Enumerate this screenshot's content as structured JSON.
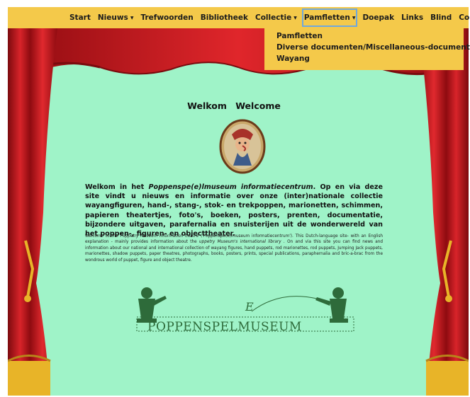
{
  "nav": {
    "items": [
      {
        "label": "Start",
        "dropdown": false
      },
      {
        "label": "Nieuws",
        "dropdown": true
      },
      {
        "label": "Trefwoorden",
        "dropdown": false
      },
      {
        "label": "Bibliotheek",
        "dropdown": false
      },
      {
        "label": "Collectie",
        "dropdown": true
      },
      {
        "label": "Pamfletten",
        "dropdown": true,
        "active": true
      },
      {
        "label": "Doepak",
        "dropdown": false
      },
      {
        "label": "Links",
        "dropdown": false
      },
      {
        "label": "Blind",
        "dropdown": false
      },
      {
        "label": "Contact",
        "dropdown": false
      }
    ],
    "caret": "▼"
  },
  "dropdown": {
    "items": [
      "Pamfletten",
      "Diverse documenten/Miscellaneous-documentation",
      "Wayang"
    ]
  },
  "main": {
    "title": "Welkom Welcome",
    "nl_prefix": "Welkom in het ",
    "nl_italic": "Poppenspe(e)lmuseum informatiecentrum",
    "nl_rest": ". Op en via deze site vindt u nieuws en informatie over onze (inter)nationale collectie wayangfiguren, hand-, stang-, stok- en trekpoppen, marionetten, schimmen, papieren theatertjes, foto's, boeken, posters, prenten, documentatie, bijzondere uitgaven, parafernalia en snuisterijen uit de wonderwereld van het poppen-, figuren- en objecttheater.",
    "en_prefix": "Welcome to the ",
    "en_italic1": "Puppetry Museum Information Centre",
    "en_mid": " ('Poppenspe(e)lmuseum informatiecentrum'). This Dutch-language site- with an English explanation - mainly provides information about the ",
    "en_italic2": "uppetry Museum's international library",
    "en_rest": " . On and via this site you can find news and information about our national and international collection of wayang figures, hand puppets, rod marionettes, rod puppets, Jumping Jack puppets, marionettes, shadow puppets, paper theatres, photographs, books, posters, prints, special publications, paraphernalia and bric-a-brac from the wondrous world of puppet, figure and object theatre.",
    "logo_text": "POPPENSPELMUSEUM",
    "logo_e": "E"
  },
  "colors": {
    "background": "#9ff3c8",
    "navbar": "#f4c94a",
    "curtain": "#c4161c",
    "gold": "#e8b428",
    "logo": "#2e6b3a"
  }
}
